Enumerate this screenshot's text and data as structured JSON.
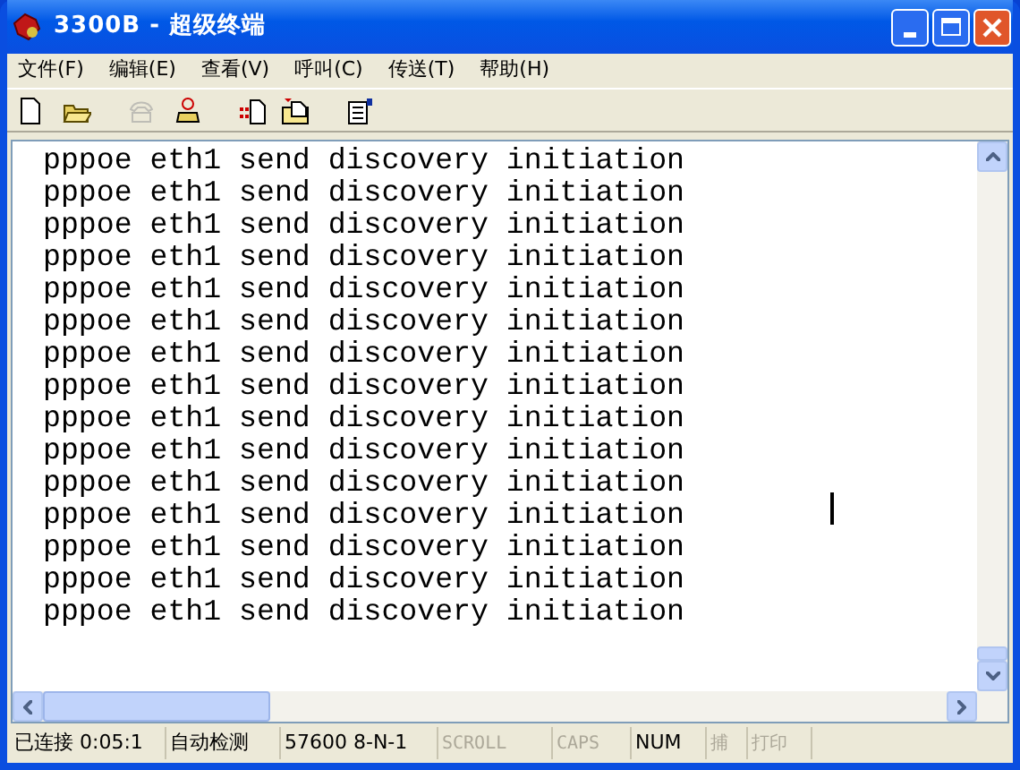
{
  "window": {
    "title": "3300B - 超级终端"
  },
  "menu": [
    "文件(F)",
    "编辑(E)",
    "查看(V)",
    "呼叫(C)",
    "传送(T)",
    "帮助(H)"
  ],
  "toolbar": [
    {
      "kind": "new",
      "disabled": false
    },
    {
      "kind": "open",
      "disabled": false
    },
    {
      "kind": "call",
      "disabled": true
    },
    {
      "kind": "hangup",
      "disabled": false
    },
    {
      "kind": "send",
      "disabled": false
    },
    {
      "kind": "receive",
      "disabled": false
    },
    {
      "kind": "properties",
      "disabled": false
    }
  ],
  "terminal": {
    "lines": [
      "pppoe eth1 send discovery initiation",
      "pppoe eth1 send discovery initiation",
      "pppoe eth1 send discovery initiation",
      "pppoe eth1 send discovery initiation",
      "pppoe eth1 send discovery initiation",
      "pppoe eth1 send discovery initiation",
      "pppoe eth1 send discovery initiation",
      "pppoe eth1 send discovery initiation",
      "pppoe eth1 send discovery initiation",
      "pppoe eth1 send discovery initiation",
      "pppoe eth1 send discovery initiation",
      "pppoe eth1 send discovery initiation",
      "pppoe eth1 send discovery initiation",
      "pppoe eth1 send discovery initiation",
      "pppoe eth1 send discovery initiation"
    ]
  },
  "status_bar": [
    {
      "text": "已连接 0:05:1",
      "disabled": false
    },
    {
      "text": "自动检测",
      "disabled": false
    },
    {
      "text": "57600 8-N-1",
      "disabled": false
    },
    {
      "text": "SCROLL",
      "disabled": true
    },
    {
      "text": "CAPS",
      "disabled": true
    },
    {
      "text": "NUM",
      "disabled": false
    },
    {
      "text": "捕",
      "disabled": true
    },
    {
      "text": "打印",
      "disabled": true
    }
  ]
}
